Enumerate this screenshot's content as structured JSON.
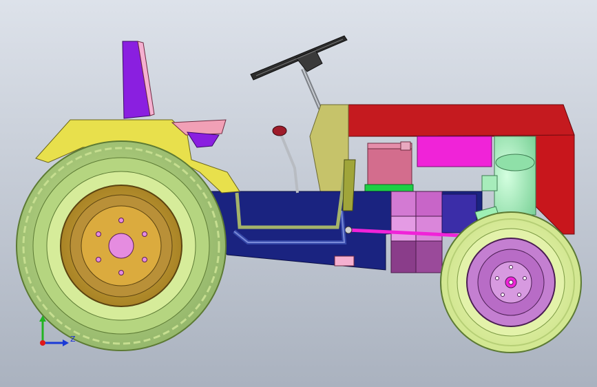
{
  "viewport": {
    "background_top": "#dbe0e8",
    "background_bottom": "#aeb5c2"
  },
  "model": {
    "name": "tractor-assembly",
    "parts": [
      "seat-back",
      "seat-cushion",
      "rear-fender",
      "rear-tire",
      "rear-rim",
      "rear-hub",
      "chassis-frame",
      "gear-shift-lever",
      "steering-wheel",
      "steering-column",
      "dashboard-panel",
      "engine-hood",
      "hood-side-panel",
      "radiator-pipe",
      "fuel-tank",
      "gearbox",
      "drive-shaft",
      "brake-linkage",
      "front-tire",
      "front-rim",
      "front-axle-support"
    ],
    "colors": {
      "tire": "#a3c37a",
      "tire_light": "#d6ec9a",
      "rim": "#c9a23a",
      "hub": "#e58ce0",
      "fender": "#e8e04c",
      "seat_back": "#8a1fe0",
      "seat_cushion": "#f1a0b6",
      "chassis": "#1a2380",
      "hood": "#c8161c",
      "panel": "#c6c36a",
      "magenta": "#f023d8",
      "pipe": "#9ef0b4",
      "front_rim": "#c47fd1",
      "steering": "#2c2c2c"
    }
  },
  "triad": {
    "z_label": "Z"
  }
}
